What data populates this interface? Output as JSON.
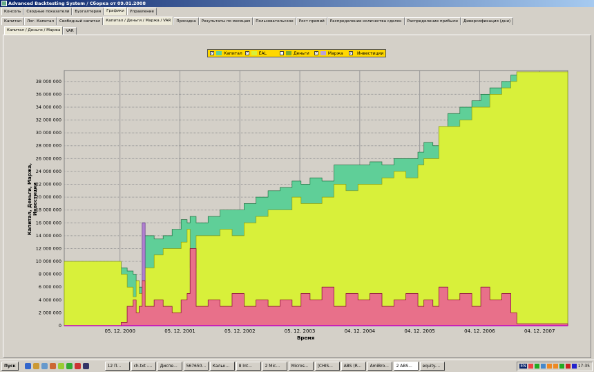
{
  "window": {
    "title": "Advanced Backtesting System / Сборка от 09.01.2008"
  },
  "tabs_main": [
    {
      "label": "Консоль"
    },
    {
      "label": "Сводные показатели"
    },
    {
      "label": "Бухгалтерия"
    },
    {
      "label": "Графики",
      "active": true
    },
    {
      "label": "Управление"
    }
  ],
  "tabs_charts": [
    {
      "label": "Капитал"
    },
    {
      "label": "Лог. Капитал"
    },
    {
      "label": "Свободный капитал"
    },
    {
      "label": "Капитал / Деньги / Маржа / VAR",
      "active": true
    },
    {
      "label": "Просадка"
    },
    {
      "label": "Результаты по месяцам"
    },
    {
      "label": "Пользовательское"
    },
    {
      "label": "Рост премий"
    },
    {
      "label": "Распределение количества сделок"
    },
    {
      "label": "Распределение прибыли"
    },
    {
      "label": "Диверсификация (дни)"
    }
  ],
  "tabs_sub": [
    {
      "label": "Капитал / Деньги / Маржа",
      "active": true
    },
    {
      "label": "VAR"
    }
  ],
  "chart_data": {
    "type": "area",
    "xlabel": "Время",
    "ylabel": "Капитал, Деньги, Маржа, Инвестиции",
    "xlim": [
      2000.0,
      2008.4
    ],
    "ylim": [
      0,
      39700000
    ],
    "x_ticks": [
      {
        "value": 2000.93,
        "label": "05. 12. 2000"
      },
      {
        "value": 2001.93,
        "label": "05. 12. 2001"
      },
      {
        "value": 2002.93,
        "label": "05. 12. 2002"
      },
      {
        "value": 2003.93,
        "label": "05. 12. 2003"
      },
      {
        "value": 2004.93,
        "label": "04. 12. 2004"
      },
      {
        "value": 2005.93,
        "label": "04. 12. 2005"
      },
      {
        "value": 2006.93,
        "label": "04. 12. 2006"
      },
      {
        "value": 2007.93,
        "label": "04. 12. 2007"
      }
    ],
    "y_ticks": [
      {
        "value": 0,
        "label": "0"
      },
      {
        "value": 2000000,
        "label": "2 000 000"
      },
      {
        "value": 4000000,
        "label": "4 000 000"
      },
      {
        "value": 6000000,
        "label": "6 000 000"
      },
      {
        "value": 8000000,
        "label": "8 000 000"
      },
      {
        "value": 10000000,
        "label": "10 000 000"
      },
      {
        "value": 12000000,
        "label": "12 000 000"
      },
      {
        "value": 14000000,
        "label": "14 000 000"
      },
      {
        "value": 16000000,
        "label": "16 000 000"
      },
      {
        "value": 18000000,
        "label": "18 000 000"
      },
      {
        "value": 20000000,
        "label": "20 000 000"
      },
      {
        "value": 22000000,
        "label": "22 000 000"
      },
      {
        "value": 24000000,
        "label": "24 000 000"
      },
      {
        "value": 26000000,
        "label": "26 000 000"
      },
      {
        "value": 28000000,
        "label": "28 000 000"
      },
      {
        "value": 30000000,
        "label": "30 000 000"
      },
      {
        "value": 32000000,
        "label": "32 000 000"
      },
      {
        "value": 34000000,
        "label": "34 000 000"
      },
      {
        "value": 36000000,
        "label": "36 000 000"
      },
      {
        "value": 38000000,
        "label": "38 000 000"
      }
    ],
    "legend": [
      {
        "label": "Капитал",
        "color": "#5fcf98",
        "checked": true
      },
      {
        "label": "EAL",
        "color": "#d8f03a",
        "checked": true
      },
      {
        "label": "Деньги",
        "color": "#7aa830",
        "checked": false
      },
      {
        "label": "Маржа",
        "color": "#b8a0d8",
        "checked": true
      },
      {
        "label": "Инвестиции",
        "color": "#f070b0",
        "checked": true
      }
    ],
    "x": [
      2000.0,
      2000.9,
      2000.95,
      2001.05,
      2001.15,
      2001.2,
      2001.25,
      2001.3,
      2001.35,
      2001.5,
      2001.65,
      2001.8,
      2001.95,
      2002.05,
      2002.1,
      2002.2,
      2002.4,
      2002.6,
      2002.8,
      2003.0,
      2003.2,
      2003.4,
      2003.6,
      2003.8,
      2003.95,
      2004.1,
      2004.3,
      2004.5,
      2004.7,
      2004.9,
      2005.1,
      2005.3,
      2005.5,
      2005.7,
      2005.9,
      2006.0,
      2006.15,
      2006.25,
      2006.4,
      2006.6,
      2006.8,
      2006.95,
      2007.1,
      2007.3,
      2007.45,
      2007.55,
      2008.4
    ],
    "series": [
      {
        "name": "Капитал",
        "values": [
          10,
          10,
          9,
          8.5,
          8,
          7,
          6,
          16,
          14,
          13.5,
          14,
          15,
          16.5,
          16,
          17,
          16,
          17,
          18,
          18,
          19,
          20,
          21,
          21.5,
          22.5,
          22,
          23,
          22.5,
          25,
          25,
          25,
          25.5,
          25,
          26,
          26,
          27,
          28.5,
          28,
          31,
          33,
          34,
          35,
          36,
          37,
          38,
          39,
          39.5,
          39.5
        ],
        "unit": "M"
      },
      {
        "name": "EAL",
        "values": [
          10,
          10,
          8,
          6,
          4.5,
          7,
          5,
          7,
          9,
          11,
          12,
          12,
          13,
          15,
          9,
          14,
          14,
          15,
          14,
          16,
          17,
          18,
          18,
          20,
          19,
          19,
          20,
          22,
          21,
          22,
          22,
          23,
          24,
          23,
          25,
          26,
          26,
          31,
          31,
          32,
          34,
          34,
          36,
          37,
          38,
          39.5,
          39.5
        ],
        "unit": "M"
      },
      {
        "name": "Маржа",
        "values": [
          0,
          0,
          0.5,
          3,
          4,
          2,
          3,
          16,
          3,
          4,
          3,
          2,
          4,
          5,
          12,
          3,
          4,
          3,
          5,
          3,
          4,
          3,
          4,
          3,
          5,
          4,
          6,
          3,
          5,
          4,
          5,
          3,
          4,
          5,
          3,
          4,
          3,
          6,
          4,
          5,
          3,
          6,
          4,
          5,
          2,
          0.3,
          0.1
        ],
        "unit": "M"
      },
      {
        "name": "Инвестиции",
        "values": [
          0,
          0,
          0.5,
          3,
          4,
          2,
          3,
          7,
          3,
          4,
          3,
          2,
          4,
          5,
          12,
          3,
          4,
          3,
          5,
          3,
          4,
          3,
          4,
          3,
          5,
          4,
          6,
          3,
          5,
          4,
          5,
          3,
          4,
          5,
          3,
          4,
          3,
          6,
          4,
          5,
          3,
          6,
          4,
          5,
          2,
          0.3,
          0.1
        ],
        "unit": "M"
      }
    ]
  },
  "taskbar": {
    "start": "Пуск",
    "items": [
      "12 П...",
      "ch.txt -...",
      "Диспе...",
      "567650...",
      "Кальк...",
      "8 Int...",
      "2 Mic...",
      "Micros...",
      "[CHIS...",
      "ABS (R...",
      "AmiBro...",
      "2 ABS...",
      "equity...."
    ],
    "lang": "EN",
    "clock": "17:35"
  }
}
